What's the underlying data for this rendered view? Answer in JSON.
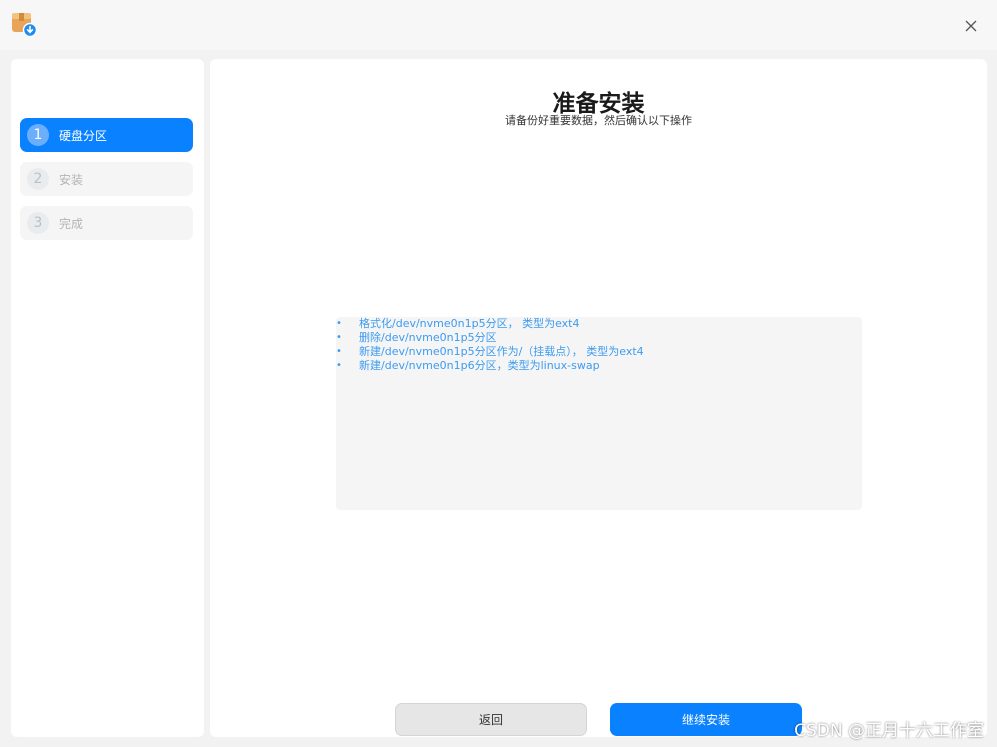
{
  "window": {
    "app_icon": "package-download-icon",
    "close_icon": "close-icon"
  },
  "sidebar": {
    "steps": [
      {
        "number": "1",
        "label": "硬盘分区",
        "active": true
      },
      {
        "number": "2",
        "label": "安装",
        "active": false
      },
      {
        "number": "3",
        "label": "完成",
        "active": false
      }
    ]
  },
  "main": {
    "title": "准备安装",
    "subtitle": "请备份好重要数据，然后确认以下操作",
    "operations": [
      "格式化/dev/nvme0n1p5分区，  类型为ext4",
      "删除/dev/nvme0n1p5分区",
      "新建/dev/nvme0n1p5分区作为/（挂载点），  类型为ext4",
      "新建/dev/nvme0n1p6分区，类型为linux-swap"
    ],
    "bullet": "•"
  },
  "buttons": {
    "back_label": "返回",
    "continue_label": "继续安装"
  },
  "watermark": "CSDN @正月十六工作室",
  "colors": {
    "accent": "#0a81ff",
    "operation_text": "#3d9bf0"
  }
}
